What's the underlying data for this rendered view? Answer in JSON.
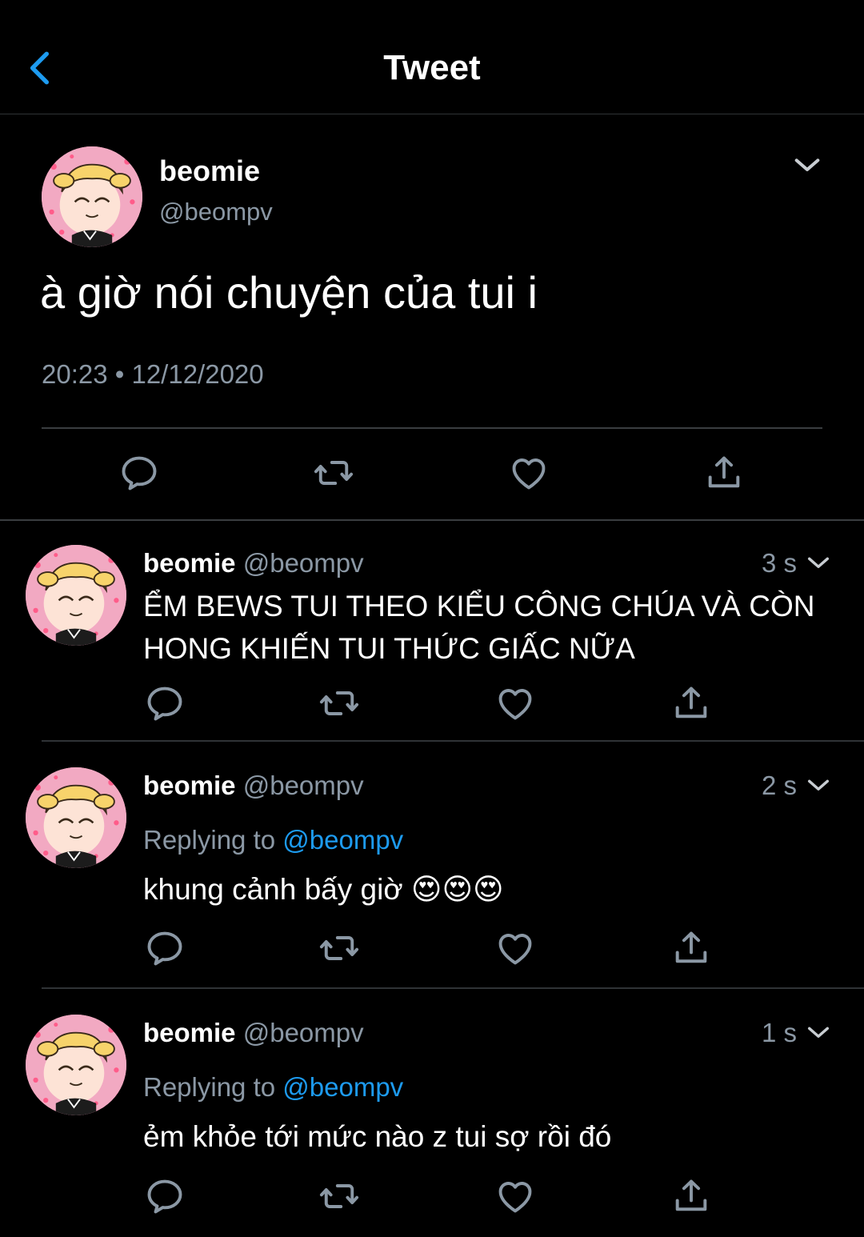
{
  "header": {
    "title": "Tweet"
  },
  "main_tweet": {
    "name": "beomie",
    "handle": "@beompv",
    "text": "à giờ nói chuyện của tui i",
    "meta": "20:23 • 12/12/2020"
  },
  "replies": [
    {
      "name": "beomie",
      "handle": "@beompv",
      "time": "3 s",
      "replying_label": "",
      "replying_to": "",
      "text": "ỂM BEWS TUI THEO KIỂU CÔNG CHÚA VÀ CÒN HONG KHIẾN TUI THỨC GIẤC NỮA"
    },
    {
      "name": "beomie",
      "handle": "@beompv",
      "time": "2 s",
      "replying_label": "Replying to",
      "replying_to": "@beompv",
      "text": "khung cảnh bấy giờ 😍😍😍"
    },
    {
      "name": "beomie",
      "handle": "@beompv",
      "time": "1 s",
      "replying_label": "Replying to",
      "replying_to": "@beompv",
      "text": "ẻm khỏe tới mức nào z tui sợ rồi đó"
    }
  ],
  "icons": {
    "back": "chevron-left-icon",
    "menu": "chevron-down-icon",
    "reply": "reply-icon",
    "retweet": "retweet-icon",
    "like": "heart-icon",
    "share": "share-icon"
  },
  "colors": {
    "background": "#000000",
    "accent": "#1d9bf0",
    "secondary_text": "#8b98a5"
  }
}
